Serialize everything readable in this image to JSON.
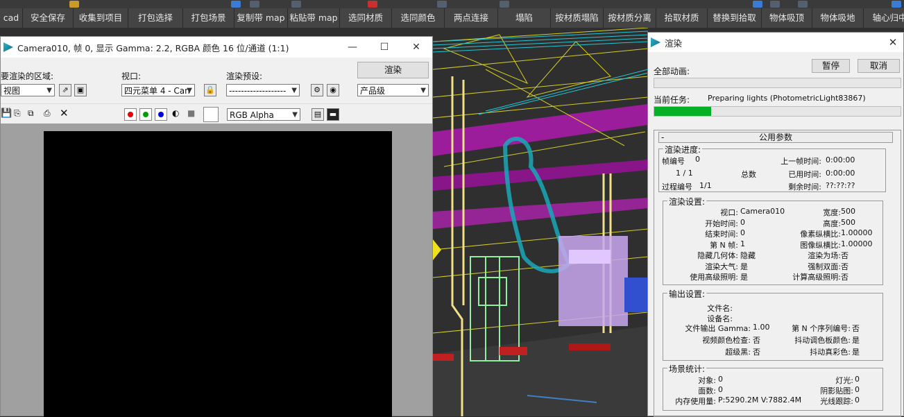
{
  "toolbar": {
    "buttons": [
      "cad",
      "安全保存",
      "收集到项目",
      "打包选择",
      "打包场景",
      "复制带 map",
      "粘贴带 map",
      "选同材质",
      "选同颜色",
      "两点连接",
      "塌陷",
      "按材质塌陷",
      "按材质分离",
      "拾取材质",
      "替换到拾取",
      "物体吸顶",
      "物体吸地",
      "轴心归中"
    ]
  },
  "frame_window": {
    "title": "Camera010, 帧 0, 显示 Gamma: 2.2, RGBA 颜色 16 位/通道 (1:1)",
    "area_label": "要渲染的区域:",
    "area_value": "视图",
    "viewport_label": "视口:",
    "viewport_value": "四元菜单 4 - Can",
    "preset_label": "渲染预设:",
    "preset_value": "-------------------",
    "render_button": "渲染",
    "quality_value": "产品级",
    "channel_value": "RGB Alpha",
    "colors": {
      "red": "#e00000",
      "green": "#00a000",
      "blue": "#0000e0"
    }
  },
  "render_window": {
    "title": "渲染",
    "pause_button": "暂停",
    "cancel_button": "取消",
    "all_anim_label": "全部动画:",
    "all_anim_progress": 0,
    "current_task_label": "当前任务:",
    "current_task_value": "Preparing lights (PhotometricLight83867)",
    "current_task_progress": 0.23,
    "rollout_title": "公用参数",
    "progress_group": {
      "title": "渲染进度:",
      "frame_no_label": "帧编号",
      "frame_no_value": "0",
      "last_frame_label": "上一帧时间:",
      "last_frame_value": "0:00:00",
      "frames_value": "1   / 1",
      "total_label": "总数",
      "elapsed_label": "已用时间:",
      "elapsed_value": "0:00:00",
      "pass_label": "过程编号",
      "pass_value": "1/1",
      "remaining_label": "剩余时间:",
      "remaining_value": "??:??:??"
    },
    "settings_group": {
      "title": "渲染设置:",
      "left": [
        [
          "视口:",
          "Camera010"
        ],
        [
          "开始时间:",
          "0"
        ],
        [
          "结束时间:",
          "0"
        ],
        [
          "第 N 帧:",
          "1"
        ],
        [
          "隐藏几何体:",
          "隐藏"
        ],
        [
          "渲染大气:",
          "是"
        ],
        [
          "使用高级照明:",
          "是"
        ]
      ],
      "right": [
        [
          "宽度:",
          "500"
        ],
        [
          "高度:",
          "500"
        ],
        [
          "像素纵横比:",
          "1.00000"
        ],
        [
          "图像纵横比:",
          "1.00000"
        ],
        [
          "渲染为场:",
          "否"
        ],
        [
          "强制双面:",
          "否"
        ],
        [
          "计算高级照明:",
          "否"
        ]
      ]
    },
    "output_group": {
      "title": "输出设置:",
      "file_name_label": "文件名:",
      "device_name_label": "设备名:",
      "left": [
        [
          "文件输出 Gamma:",
          "1.00"
        ],
        [
          "视频颜色检查:",
          "否"
        ],
        [
          "超级黑:",
          "否"
        ]
      ],
      "right": [
        [
          "第 N 个序列编号:",
          "否"
        ],
        [
          "抖动调色板颜色:",
          "是"
        ],
        [
          "抖动真彩色:",
          "是"
        ]
      ]
    },
    "stats_group": {
      "title": "场景统计:",
      "left": [
        [
          "对象:",
          "0"
        ],
        [
          "面数:",
          "0"
        ],
        [
          "内存使用量:",
          "P:5290.2M V:7882.4M"
        ]
      ],
      "right": [
        [
          "灯光:",
          "0"
        ],
        [
          "阴影贴图:",
          "0"
        ],
        [
          "光线跟踪:",
          "0"
        ]
      ]
    }
  }
}
